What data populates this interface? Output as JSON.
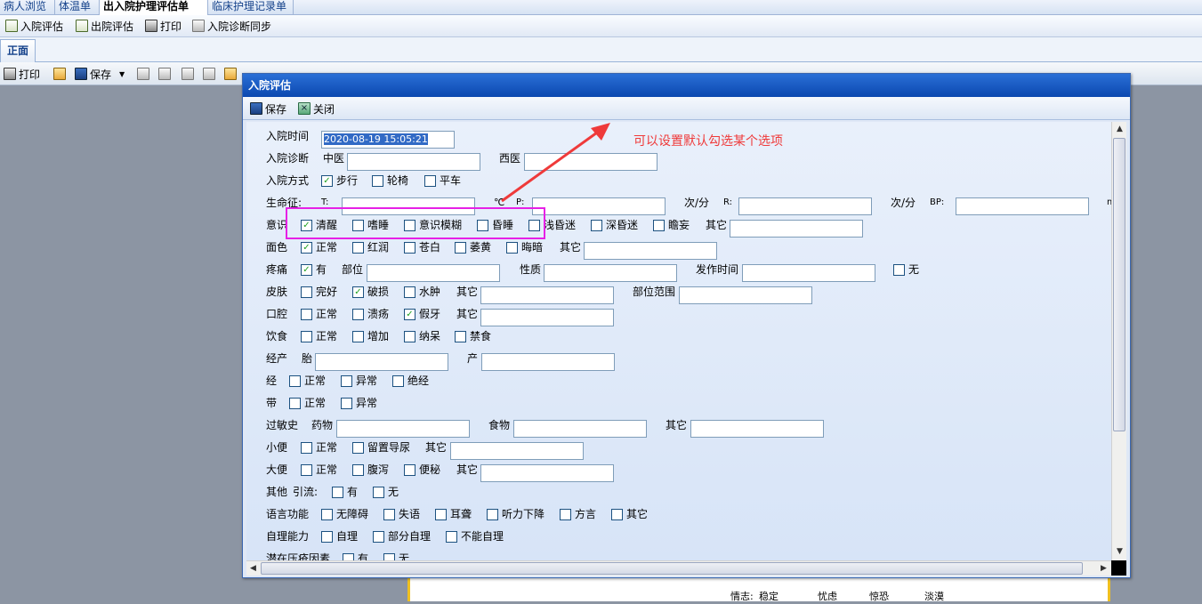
{
  "top_tabs": [
    {
      "label": "病人浏览",
      "active": false
    },
    {
      "label": "体温单",
      "active": false
    },
    {
      "label": "出入院护理评估单",
      "active": true
    },
    {
      "label": "临床护理记录单",
      "active": false
    }
  ],
  "toolbar1": {
    "admit_assess": "入院评估",
    "discharge_assess": "出院评估",
    "print": "打印",
    "diagnosis_sync": "入院诊断同步"
  },
  "subtab": "正面",
  "toolbar3": {
    "print": "打印",
    "save": "保存"
  },
  "dialog": {
    "title": "入院评估",
    "save": "保存",
    "close": "关闭",
    "admit_time_label": "入院时间",
    "admit_time_value": "2020-08-19 15:05:21",
    "diag_label": "入院诊断",
    "tcm_label": "中医",
    "western_label": "西医",
    "admit_mode_label": "入院方式",
    "admit_mode_opts": [
      "步行",
      "轮椅",
      "平车"
    ],
    "vital_label": "生命征:",
    "t_label": "T:",
    "t_unit": "℃",
    "p_label": "P:",
    "p_unit": "次/分",
    "r_label": "R:",
    "r_unit": "次/分",
    "bp_label": "BP:",
    "bp_unit": "m",
    "conscious_label": "意识",
    "conscious_opts": [
      "清醒",
      "嗜睡",
      "意识模糊",
      "昏睡",
      "浅昏迷",
      "深昏迷",
      "瞻妄"
    ],
    "other": "其它",
    "complexion_label": "面色",
    "complexion_opts": [
      "正常",
      "红润",
      "苍白",
      "萎黄",
      "晦暗"
    ],
    "pain_label": "疼痛",
    "pain_yes": "有",
    "pain_site": "部位",
    "pain_nature": "性质",
    "pain_time": "发作时间",
    "pain_none": "无",
    "skin_label": "皮肤",
    "skin_opts": [
      "完好",
      "破损",
      "水肿"
    ],
    "skin_range": "部位范围",
    "mouth_label": "口腔",
    "mouth_opts": [
      "正常",
      "溃疡",
      "假牙"
    ],
    "diet_label": "饮食",
    "diet_opts": [
      "正常",
      "增加",
      "纳呆",
      "禁食"
    ],
    "parity_label": "经产",
    "fetus_label": "胎",
    "birth_label": "产",
    "menses_label": "经",
    "menses_opts": [
      "正常",
      "异常",
      "绝经"
    ],
    "leuk_label": "带",
    "leuk_opts": [
      "正常",
      "异常"
    ],
    "allergy_label": "过敏史",
    "drug_label": "药物",
    "food_label": "食物",
    "urine_label": "小便",
    "urine_opts": [
      "正常",
      "留置导尿"
    ],
    "stool_label": "大便",
    "stool_opts": [
      "正常",
      "腹泻",
      "便秘"
    ],
    "misc_label": "其他",
    "drain_label": "引流:",
    "drain_opts": [
      "有",
      "无"
    ],
    "speech_label": "语言功能",
    "speech_opts": [
      "无障碍",
      "失语",
      "耳聋",
      "听力下降",
      "方言",
      "其它"
    ],
    "self_label": "自理能力",
    "self_opts": [
      "自理",
      "部分自理",
      "不能自理"
    ],
    "sore_label": "潜在压疮因素",
    "sore_opts": [
      "有",
      "无"
    ]
  },
  "annotation": "可以设置默认勾选某个选项",
  "behind_page": {
    "mood_label": "情志:",
    "opts": [
      "稳定",
      "忧虑",
      "惊恐",
      "淡漠"
    ]
  },
  "colors": {
    "title_bar": "#0b48b0",
    "highlight": "#e621e6",
    "annotation": "#ef3a3a",
    "check": "#21a121"
  }
}
